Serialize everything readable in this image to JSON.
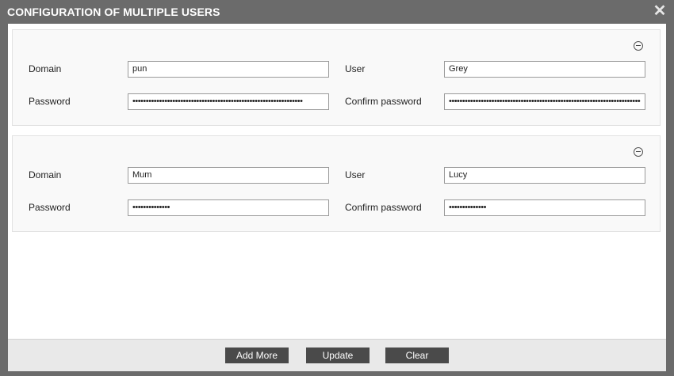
{
  "dialog": {
    "title": "CONFIGURATION OF MULTIPLE USERS",
    "close_glyph": "✕"
  },
  "labels": {
    "domain": "Domain",
    "user": "User",
    "password": "Password",
    "confirm_password": "Confirm password"
  },
  "users": [
    {
      "domain": "pun",
      "user": "Grey",
      "password": "••••••••••••••••••••••••••••••••••••••••••••••••••••••••••••••••",
      "confirm_password": "••••••••••••••••••••••••••••••••••••••••••••••••••••••••••••••••••••••••"
    },
    {
      "domain": "Mum",
      "user": "Lucy",
      "password": "••••••••••••••",
      "confirm_password": "••••••••••••••"
    }
  ],
  "buttons": {
    "add_more": "Add More",
    "update": "Update",
    "clear": "Clear"
  },
  "icons": {
    "close": "close-icon",
    "remove": "remove-circle-icon"
  },
  "colors": {
    "frame": "#6b6b6b",
    "button": "#4a4a4a",
    "section_bg": "#f9f9f9",
    "footer_bg": "#e9e9e9"
  }
}
